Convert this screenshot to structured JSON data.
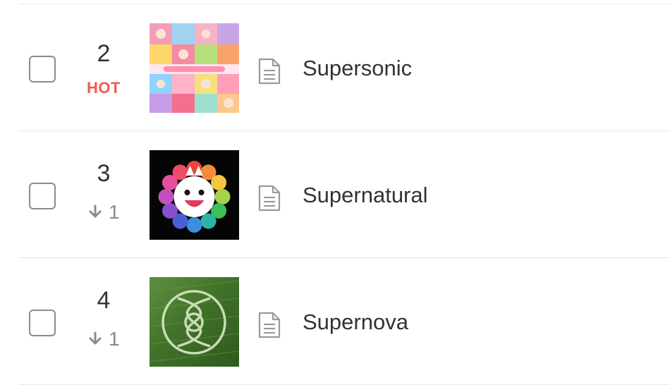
{
  "chart_rows": [
    {
      "rank": "2",
      "badge": "HOT",
      "title": "Supersonic",
      "icon": "lyrics-document-icon"
    },
    {
      "rank": "3",
      "change_icon": "arrow-down-icon",
      "change": "1",
      "title": "Supernatural",
      "icon": "lyrics-document-icon"
    },
    {
      "rank": "4",
      "change_icon": "arrow-down-icon",
      "change": "1",
      "title": "Supernova",
      "icon": "lyrics-document-icon"
    }
  ],
  "colors": {
    "hot_badge": "#ef5a4a",
    "rank_change": "#8a8a8a",
    "divider": "#e6e6e6"
  }
}
